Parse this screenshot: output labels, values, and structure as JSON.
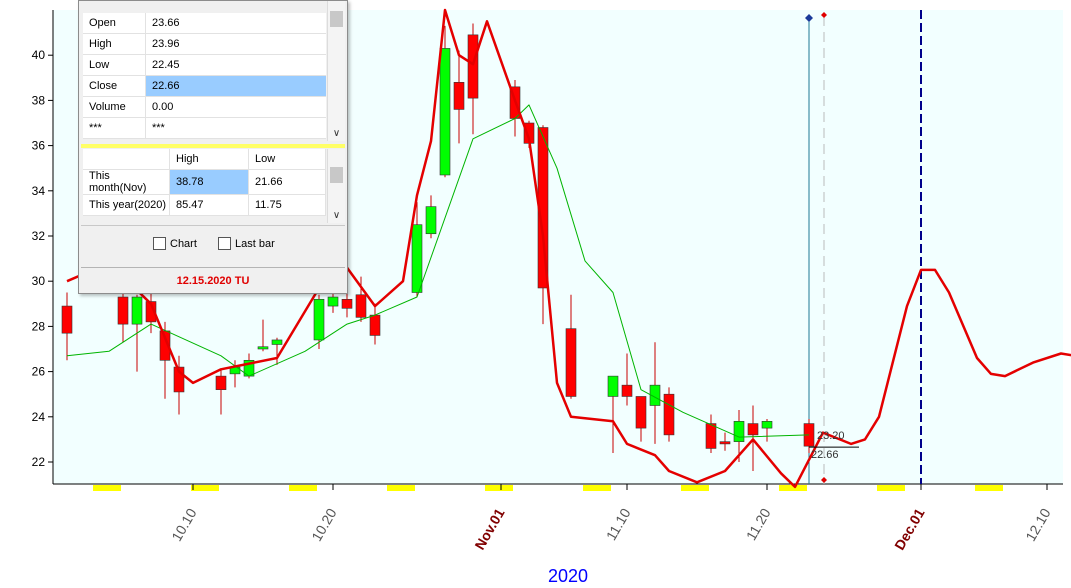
{
  "ohlc_panel": {
    "rows": [
      {
        "label": "Open",
        "value": "23.66"
      },
      {
        "label": "High",
        "value": "23.96"
      },
      {
        "label": "Low",
        "value": "22.45"
      },
      {
        "label": "Close",
        "value": "22.66"
      },
      {
        "label": "Volume",
        "value": "0.00"
      },
      {
        "label": "***",
        "value": "***"
      }
    ],
    "highlighted_row": "Close"
  },
  "high_low_panel": {
    "header": [
      "",
      "High",
      "Low"
    ],
    "rows": [
      {
        "period": "This month(Nov)",
        "high": "38.78",
        "low": "21.66"
      },
      {
        "period": "This year(2020)",
        "high": "85.47",
        "low": "11.75"
      }
    ],
    "highlighted_cell": "This month(Nov) High"
  },
  "options": {
    "chart_label": "Chart",
    "chart_checked": false,
    "lastbar_label": "Last bar",
    "lastbar_checked": false
  },
  "footer_date": "12.15.2020 TU",
  "chart_data": {
    "type": "candlestick",
    "y_tick_labels": [
      "22",
      "24",
      "26",
      "28",
      "30",
      "32",
      "34",
      "36",
      "38",
      "40"
    ],
    "x_tick_labels": [
      {
        "label": "10.10",
        "emphasis": false
      },
      {
        "label": "10.20",
        "emphasis": false
      },
      {
        "label": "Nov.01",
        "emphasis": true
      },
      {
        "label": "11.10",
        "emphasis": false
      },
      {
        "label": "11.20",
        "emphasis": false
      },
      {
        "label": "Dec.01",
        "emphasis": true
      },
      {
        "label": "12.10",
        "emphasis": false
      }
    ],
    "xlabel": "2020",
    "ylim": [
      21,
      41.9
    ],
    "annotations": {
      "ma_value": "23.20",
      "close_value": "22.66"
    },
    "candles": [
      {
        "d": "10.01",
        "o": 28.9,
        "h": 29.5,
        "l": 26.5,
        "c": 27.7
      },
      {
        "d": "10.05",
        "o": 29.3,
        "h": 30.2,
        "l": 27.3,
        "c": 28.1
      },
      {
        "d": "10.06",
        "o": 28.1,
        "h": 29.4,
        "l": 26.0,
        "c": 29.3
      },
      {
        "d": "10.07",
        "o": 29.1,
        "h": 29.9,
        "l": 27.7,
        "c": 28.2
      },
      {
        "d": "10.08",
        "o": 27.8,
        "h": 28.2,
        "l": 24.8,
        "c": 26.5
      },
      {
        "d": "10.09",
        "o": 26.2,
        "h": 26.7,
        "l": 24.1,
        "c": 25.1
      },
      {
        "d": "10.12",
        "o": 25.8,
        "h": 26.1,
        "l": 24.1,
        "c": 25.2
      },
      {
        "d": "10.13",
        "o": 25.9,
        "h": 26.5,
        "l": 25.3,
        "c": 26.2
      },
      {
        "d": "10.14",
        "o": 25.8,
        "h": 26.8,
        "l": 25.7,
        "c": 26.5
      },
      {
        "d": "10.15",
        "o": 27.0,
        "h": 28.3,
        "l": 26.9,
        "c": 27.1
      },
      {
        "d": "10.16",
        "o": 27.2,
        "h": 27.5,
        "l": 26.3,
        "c": 27.4
      },
      {
        "d": "10.19",
        "o": 27.4,
        "h": 29.4,
        "l": 27.0,
        "c": 29.2
      },
      {
        "d": "10.20",
        "o": 28.9,
        "h": 30.2,
        "l": 28.6,
        "c": 29.3
      },
      {
        "d": "10.21",
        "o": 29.2,
        "h": 30.0,
        "l": 28.4,
        "c": 28.8
      },
      {
        "d": "10.22",
        "o": 29.4,
        "h": 30.2,
        "l": 28.2,
        "c": 28.4
      },
      {
        "d": "10.23",
        "o": 28.5,
        "h": 29.0,
        "l": 27.2,
        "c": 27.6
      },
      {
        "d": "10.26",
        "o": 29.5,
        "h": 33.5,
        "l": 29.3,
        "c": 32.5
      },
      {
        "d": "10.27",
        "o": 32.1,
        "h": 33.8,
        "l": 31.9,
        "c": 33.3
      },
      {
        "d": "10.28",
        "o": 34.7,
        "h": 41.3,
        "l": 34.6,
        "c": 40.3
      },
      {
        "d": "10.29",
        "o": 38.8,
        "h": 40.2,
        "l": 36.1,
        "c": 37.6
      },
      {
        "d": "10.30",
        "o": 40.9,
        "h": 41.4,
        "l": 36.5,
        "c": 38.1
      },
      {
        "d": "11.02",
        "o": 38.6,
        "h": 38.9,
        "l": 36.4,
        "c": 37.2
      },
      {
        "d": "11.03",
        "o": 37.0,
        "h": 37.1,
        "l": 35.9,
        "c": 36.1
      },
      {
        "d": "11.04",
        "o": 36.8,
        "h": 36.9,
        "l": 28.1,
        "c": 29.7
      },
      {
        "d": "11.06",
        "o": 27.9,
        "h": 29.4,
        "l": 24.8,
        "c": 24.9
      },
      {
        "d": "11.09",
        "o": 24.9,
        "h": 25.3,
        "l": 22.4,
        "c": 25.8
      },
      {
        "d": "11.10",
        "o": 25.4,
        "h": 26.8,
        "l": 24.5,
        "c": 24.9
      },
      {
        "d": "11.11",
        "o": 24.9,
        "h": 24.8,
        "l": 22.9,
        "c": 23.5
      },
      {
        "d": "11.12",
        "o": 24.5,
        "h": 27.3,
        "l": 22.8,
        "c": 25.4
      },
      {
        "d": "11.13",
        "o": 25.0,
        "h": 25.3,
        "l": 22.9,
        "c": 23.2
      },
      {
        "d": "11.16",
        "o": 23.7,
        "h": 24.1,
        "l": 22.4,
        "c": 22.6
      },
      {
        "d": "11.17",
        "o": 22.9,
        "h": 23.3,
        "l": 22.5,
        "c": 22.8
      },
      {
        "d": "11.18",
        "o": 22.9,
        "h": 24.3,
        "l": 22.0,
        "c": 23.8
      },
      {
        "d": "11.19",
        "o": 23.7,
        "h": 24.5,
        "l": 21.6,
        "c": 23.2
      },
      {
        "d": "11.20",
        "o": 23.5,
        "h": 23.9,
        "l": 22.9,
        "c": 23.8
      },
      {
        "d": "11.23",
        "o": 23.7,
        "h": 23.9,
        "l": 22.4,
        "c": 22.7
      }
    ],
    "series": [
      {
        "style": "thin-green",
        "points": [
          [
            "10.01",
            26.7
          ],
          [
            "10.04",
            26.9
          ],
          [
            "10.07",
            28.1
          ],
          [
            "10.12",
            26.7
          ],
          [
            "10.14",
            25.8
          ],
          [
            "10.18",
            26.9
          ],
          [
            "10.21",
            28.1
          ],
          [
            "10.23",
            28.5
          ],
          [
            "10.26",
            29.3
          ],
          [
            "10.30",
            36.3
          ],
          [
            "11.02",
            37.2
          ],
          [
            "11.03",
            37.8
          ],
          [
            "11.05",
            35.0
          ],
          [
            "11.07",
            30.9
          ],
          [
            "11.09",
            29.5
          ],
          [
            "11.11",
            25.2
          ],
          [
            "11.14",
            24.2
          ],
          [
            "11.18",
            23.1
          ],
          [
            "11.23",
            23.2
          ]
        ]
      },
      {
        "style": "thick-red",
        "points": [
          [
            "10.01",
            30.0
          ],
          [
            "10.04",
            30.8
          ],
          [
            "10.07",
            29.0
          ],
          [
            "10.09",
            26.0
          ],
          [
            "10.10",
            25.5
          ],
          [
            "10.12",
            26.1
          ],
          [
            "10.16",
            26.6
          ],
          [
            "10.19",
            29.7
          ],
          [
            "10.21",
            30.6
          ],
          [
            "10.23",
            28.9
          ],
          [
            "10.25",
            30.0
          ],
          [
            "10.26",
            33.8
          ],
          [
            "10.27",
            36.2
          ],
          [
            "10.28",
            42.0
          ],
          [
            "10.29",
            40.0
          ],
          [
            "10.30",
            39.6
          ],
          [
            "10.31",
            41.5
          ],
          [
            "11.02",
            38.0
          ],
          [
            "11.03",
            36.3
          ],
          [
            "11.04",
            32.0
          ],
          [
            "11.05",
            25.5
          ],
          [
            "11.06",
            24.0
          ],
          [
            "11.09",
            23.8
          ],
          [
            "11.10",
            22.8
          ],
          [
            "11.12",
            22.3
          ],
          [
            "11.13",
            21.6
          ],
          [
            "11.15",
            21.1
          ],
          [
            "11.17",
            21.6
          ],
          [
            "11.19",
            23.0
          ],
          [
            "11.21",
            21.5
          ],
          [
            "11.22",
            20.9
          ],
          [
            "11.24",
            23.3
          ],
          [
            "11.26",
            22.8
          ],
          [
            "11.27",
            23.0
          ],
          [
            "11.28",
            24.0
          ],
          [
            "11.30",
            28.9
          ],
          [
            "12.01",
            30.5
          ],
          [
            "12.02",
            30.5
          ],
          [
            "12.03",
            29.5
          ],
          [
            "12.05",
            26.6
          ],
          [
            "12.06",
            25.9
          ],
          [
            "12.07",
            25.8
          ],
          [
            "12.09",
            26.4
          ],
          [
            "12.11",
            26.8
          ],
          [
            "12.12",
            26.7
          ],
          [
            "12.13",
            26.3
          ]
        ]
      }
    ],
    "colors": {
      "background": "#f2ffff",
      "up_candle": "#00ff00",
      "down_candle": "#ff0000",
      "ma_line": "#00b400",
      "projection_line": "#e40000",
      "weekend_marker": "#ffff00",
      "month_label": "#800000",
      "year_label": "#0000ff"
    }
  }
}
